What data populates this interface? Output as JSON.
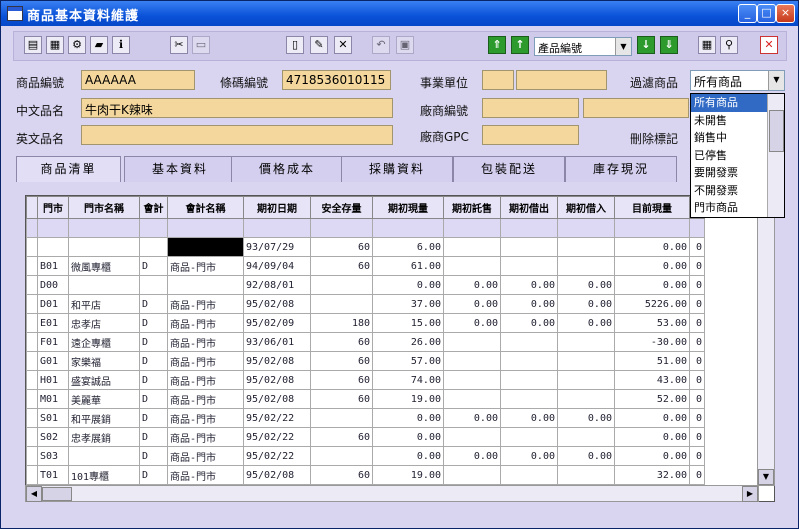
{
  "window": {
    "title": "商品基本資料維護",
    "minimize": "_",
    "maximize": "□",
    "close": "×"
  },
  "toolbar": {
    "sort_field": "產品編號"
  },
  "form": {
    "product_code_label": "商品編號",
    "product_code_value": "AAAAAA",
    "barcode_label": "條碼編號",
    "barcode_value": "4718536010115",
    "business_unit_label": "事業單位",
    "filter_label": "過濾商品",
    "filter_value": "所有商品",
    "chinese_name_label": "中文品名",
    "chinese_name_value": "牛肉干K辣味",
    "vendor_code_label": "廠商編號",
    "english_name_label": "英文品名",
    "vendor_gpc_label": "廠商GPC",
    "delete_mark_label": "刪除標記"
  },
  "filter_options": [
    "所有商品",
    "未開售",
    "銷售中",
    "已停售",
    "要開發票",
    "不開發票",
    "門市商品"
  ],
  "tabs": [
    "商品清單",
    "基本資料",
    "價格成本",
    "採購資料",
    "包裝配送",
    "庫存現況"
  ],
  "grid": {
    "columns": [
      "門市",
      "門市名稱",
      "會計",
      "會計名稱",
      "期初日期",
      "安全存量",
      "期初現量",
      "期初託售",
      "期初借出",
      "期初借入",
      "目前現量",
      ""
    ],
    "rows": [
      [
        "",
        "",
        "",
        "",
        "93/07/29",
        "60",
        "6.00",
        "",
        "",
        "",
        "0.00",
        "0"
      ],
      [
        "B01",
        "微風專櫃",
        "D",
        "商品-門市",
        "94/09/04",
        "60",
        "61.00",
        "",
        "",
        "",
        "0.00",
        "0"
      ],
      [
        "D00",
        "",
        "",
        "",
        "92/08/01",
        "",
        "0.00",
        "0.00",
        "0.00",
        "0.00",
        "0.00",
        "0"
      ],
      [
        "D01",
        "和平店",
        "D",
        "商品-門市",
        "95/02/08",
        "",
        "37.00",
        "0.00",
        "0.00",
        "0.00",
        "5226.00",
        "0"
      ],
      [
        "E01",
        "忠孝店",
        "D",
        "商品-門市",
        "95/02/09",
        "180",
        "15.00",
        "0.00",
        "0.00",
        "0.00",
        "53.00",
        "0"
      ],
      [
        "F01",
        "遠企專櫃",
        "D",
        "商品-門市",
        "93/06/01",
        "60",
        "26.00",
        "",
        "",
        "",
        "-30.00",
        "0"
      ],
      [
        "G01",
        "家樂福",
        "D",
        "商品-門市",
        "95/02/08",
        "60",
        "57.00",
        "",
        "",
        "",
        "51.00",
        "0"
      ],
      [
        "H01",
        "盛宴誠品",
        "D",
        "商品-門市",
        "95/02/08",
        "60",
        "74.00",
        "",
        "",
        "",
        "43.00",
        "0"
      ],
      [
        "M01",
        "美麗華",
        "D",
        "商品-門市",
        "95/02/08",
        "60",
        "19.00",
        "",
        "",
        "",
        "52.00",
        "0"
      ],
      [
        "S01",
        "和平展銷",
        "D",
        "商品-門市",
        "95/02/22",
        "",
        "0.00",
        "0.00",
        "0.00",
        "0.00",
        "0.00",
        "0"
      ],
      [
        "S02",
        "忠孝展銷",
        "D",
        "商品-門市",
        "95/02/22",
        "60",
        "0.00",
        "",
        "",
        "",
        "0.00",
        "0"
      ],
      [
        "S03",
        "",
        "D",
        "商品-門市",
        "95/02/22",
        "",
        "0.00",
        "0.00",
        "0.00",
        "0.00",
        "0.00",
        "0"
      ],
      [
        "T01",
        "101專櫃",
        "D",
        "商品-門市",
        "95/02/08",
        "60",
        "19.00",
        "",
        "",
        "",
        "32.00",
        "0"
      ]
    ]
  }
}
